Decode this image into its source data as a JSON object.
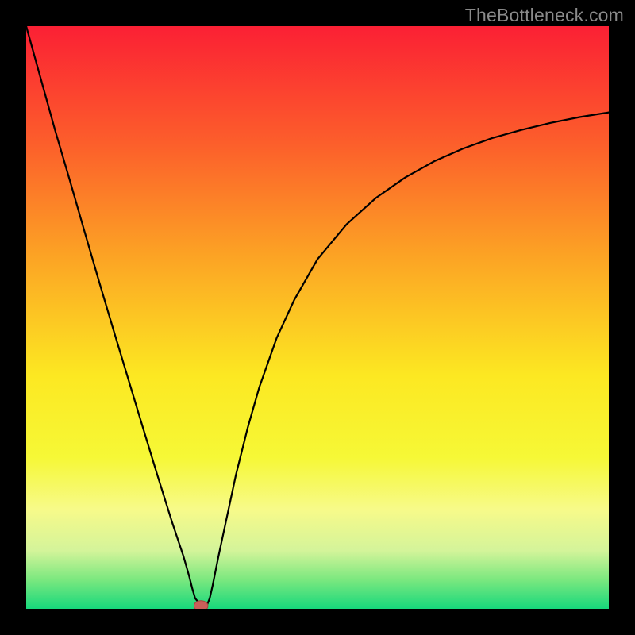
{
  "watermark": "TheBottleneck.com",
  "colors": {
    "frame": "#000000",
    "curve": "#000000",
    "marker_fill": "#c85f59",
    "marker_stroke": "#a8433d",
    "gradient_stops": [
      {
        "pct": 0,
        "hex": "#fb2034"
      },
      {
        "pct": 20,
        "hex": "#fc5e2b"
      },
      {
        "pct": 40,
        "hex": "#fca524"
      },
      {
        "pct": 60,
        "hex": "#fce822"
      },
      {
        "pct": 74,
        "hex": "#f6f836"
      },
      {
        "pct": 83,
        "hex": "#f7fa8a"
      },
      {
        "pct": 90,
        "hex": "#d4f49a"
      },
      {
        "pct": 95,
        "hex": "#7be87f"
      },
      {
        "pct": 100,
        "hex": "#17d87c"
      }
    ]
  },
  "chart_data": {
    "type": "line",
    "title": "",
    "xlabel": "",
    "ylabel": "",
    "xlim": [
      0,
      1
    ],
    "ylim": [
      0,
      1
    ],
    "marker": {
      "x": 0.3,
      "y": 0.005,
      "rx": 0.012,
      "ry": 0.009
    },
    "series": [
      {
        "name": "curve",
        "x": [
          0.0,
          0.025,
          0.05,
          0.075,
          0.1,
          0.125,
          0.15,
          0.175,
          0.2,
          0.225,
          0.25,
          0.27,
          0.28,
          0.285,
          0.29,
          0.3,
          0.31,
          0.315,
          0.32,
          0.33,
          0.345,
          0.36,
          0.38,
          0.4,
          0.43,
          0.46,
          0.5,
          0.55,
          0.6,
          0.65,
          0.7,
          0.75,
          0.8,
          0.85,
          0.9,
          0.95,
          1.0
        ],
        "y": [
          1.0,
          0.91,
          0.82,
          0.735,
          0.648,
          0.562,
          0.478,
          0.395,
          0.312,
          0.23,
          0.15,
          0.09,
          0.055,
          0.035,
          0.018,
          0.006,
          0.006,
          0.018,
          0.04,
          0.09,
          0.16,
          0.23,
          0.31,
          0.38,
          0.465,
          0.53,
          0.6,
          0.66,
          0.705,
          0.74,
          0.768,
          0.79,
          0.808,
          0.822,
          0.834,
          0.844,
          0.852
        ]
      }
    ]
  }
}
